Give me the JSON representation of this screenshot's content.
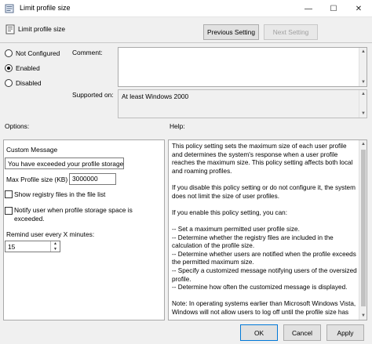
{
  "window": {
    "title": "Limit profile size",
    "controls": {
      "minimize": "—",
      "maximize": "☐",
      "close": "✕"
    }
  },
  "header": {
    "policy_name": "Limit profile size",
    "prev_button": "Previous Setting",
    "next_button": "Next Setting"
  },
  "state": {
    "options": [
      {
        "label": "Not Configured",
        "checked": false
      },
      {
        "label": "Enabled",
        "checked": true
      },
      {
        "label": "Disabled",
        "checked": false
      }
    ],
    "comment_label": "Comment:",
    "comment_value": "",
    "supported_label": "Supported on:",
    "supported_value": "At least Windows 2000"
  },
  "options_section": {
    "heading": "Options:",
    "custom_message_label": "Custom Message",
    "custom_message_value": "You have exceeded your profile storage s",
    "max_size_label": "Max Profile size (KB)",
    "max_size_value": "3000000",
    "show_registry_label": "Show registry files in the file list",
    "notify_label_line1": "Notify user when profile storage space is",
    "notify_label_line2": "exceeded.",
    "remind_label": "Remind user every X minutes:",
    "remind_value": "15"
  },
  "help_section": {
    "heading": "Help:",
    "paragraphs": [
      "This policy setting sets the maximum size of each user profile and determines the system's response when a user profile reaches the maximum size. This policy setting affects both local and roaming profiles.",
      "If you disable this policy setting or do not configure it, the system does not limit the size of user profiles.",
      "If you enable this policy setting, you can:",
      "-- Set a maximum permitted user profile size.\n-- Determine whether the registry files are included in the calculation of the profile size.\n-- Determine whether users are notified when the profile exceeds the permitted maximum size.\n-- Specify a customized message notifying users of the oversized profile.\n-- Determine how often the customized message is displayed.",
      "Note: In operating systems earlier than Microsoft Windows Vista, Windows will not allow users to log off until the profile size has"
    ]
  },
  "footer": {
    "ok": "OK",
    "cancel": "Cancel",
    "apply": "Apply"
  }
}
